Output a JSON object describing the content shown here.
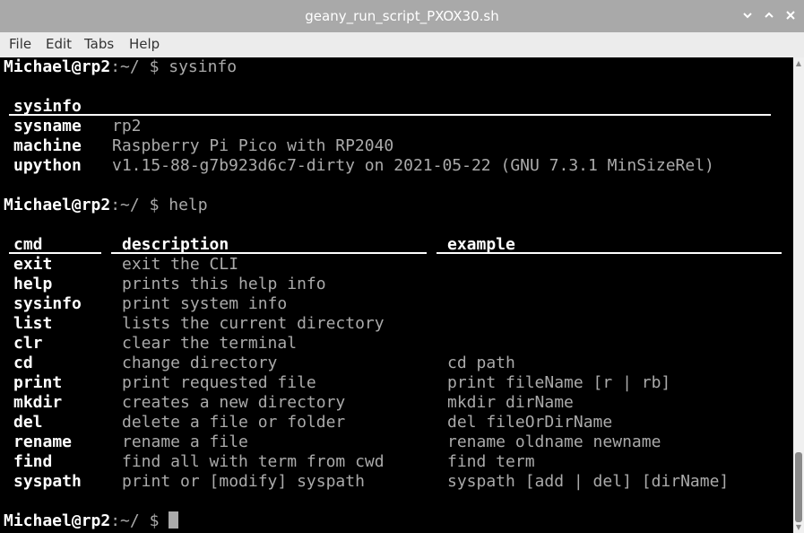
{
  "window": {
    "title": "geany_run_script_PXOX30.sh",
    "minimize_icon": "chevron-down-icon",
    "maximize_icon": "chevron-up-icon",
    "close_icon": "close-icon"
  },
  "menu": [
    "File",
    "Edit",
    "Tabs",
    "Help"
  ],
  "terminal": {
    "prompt_user": "Michael@rp2",
    "prompt_path": ":~/ $ ",
    "cmd1": "sysinfo",
    "sysinfo_header": "sysinfo",
    "sysinfo_rows": [
      {
        "key": "sysname",
        "value": "rp2"
      },
      {
        "key": "machine",
        "value": "Raspberry Pi Pico with RP2040"
      },
      {
        "key": "upython",
        "value": "v1.15-88-g7b923d6c7-dirty on 2021-05-22 (GNU 7.3.1 MinSizeRel)"
      }
    ],
    "cmd2": "help",
    "help_headers": [
      "cmd",
      "description",
      "example"
    ],
    "help_rows": [
      {
        "cmd": "exit",
        "desc": "exit the CLI",
        "example": ""
      },
      {
        "cmd": "help",
        "desc": "prints this help info",
        "example": ""
      },
      {
        "cmd": "sysinfo",
        "desc": "print system info",
        "example": ""
      },
      {
        "cmd": "list",
        "desc": "lists the current directory",
        "example": ""
      },
      {
        "cmd": "clr",
        "desc": "clear the terminal",
        "example": ""
      },
      {
        "cmd": "cd",
        "desc": "change directory",
        "example": "cd path"
      },
      {
        "cmd": "print",
        "desc": "print requested file",
        "example": "print fileName [r | rb]"
      },
      {
        "cmd": "mkdir",
        "desc": "creates a new directory",
        "example": "mkdir dirName"
      },
      {
        "cmd": "del",
        "desc": "delete a file or folder",
        "example": "del fileOrDirName"
      },
      {
        "cmd": "rename",
        "desc": "rename a file",
        "example": "rename oldname newname"
      },
      {
        "cmd": "find",
        "desc": "find all with term from cwd",
        "example": "find term"
      },
      {
        "cmd": "syspath",
        "desc": "print or [modify] syspath",
        "example": "syspath [add | del] [dirName]"
      }
    ]
  }
}
